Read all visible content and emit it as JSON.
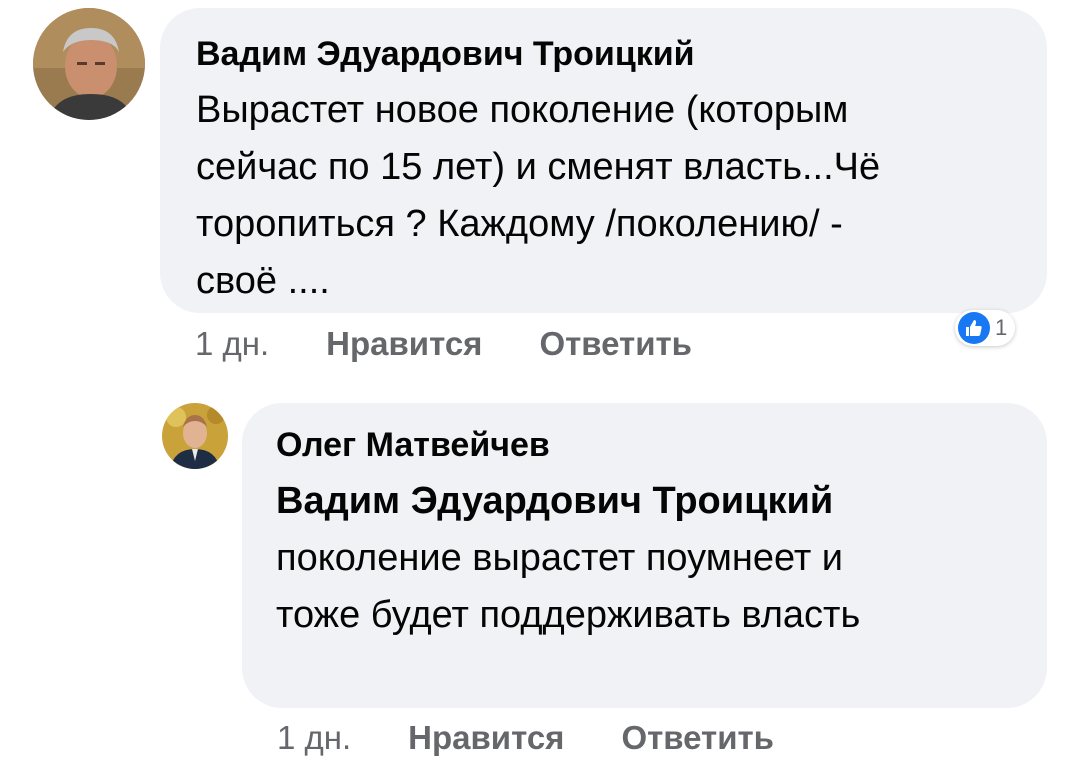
{
  "comment": {
    "author": "Вадим Эдуардович Троицкий",
    "lines": [
      "Вырастет новое поколение (которым",
      "сейчас по 15 лет) и сменят власть...Чё",
      "торопиться ? Каждому /поколению/ -",
      "своё ...."
    ],
    "time": "1 дн.",
    "like_label": "Нравится",
    "reply_label": "Ответить",
    "reaction_count": "1",
    "reaction_icon": "thumbs-up-icon",
    "accent_color": "#1877f2"
  },
  "reply": {
    "author": "Олег Матвейчев",
    "mention": "Вадим Эдуардович Троицкий",
    "lines": [
      "поколение вырастет поумнеет и",
      "тоже будет поддерживать власть"
    ],
    "time": "1 дн.",
    "like_label": "Нравится",
    "reply_label": "Ответить"
  }
}
